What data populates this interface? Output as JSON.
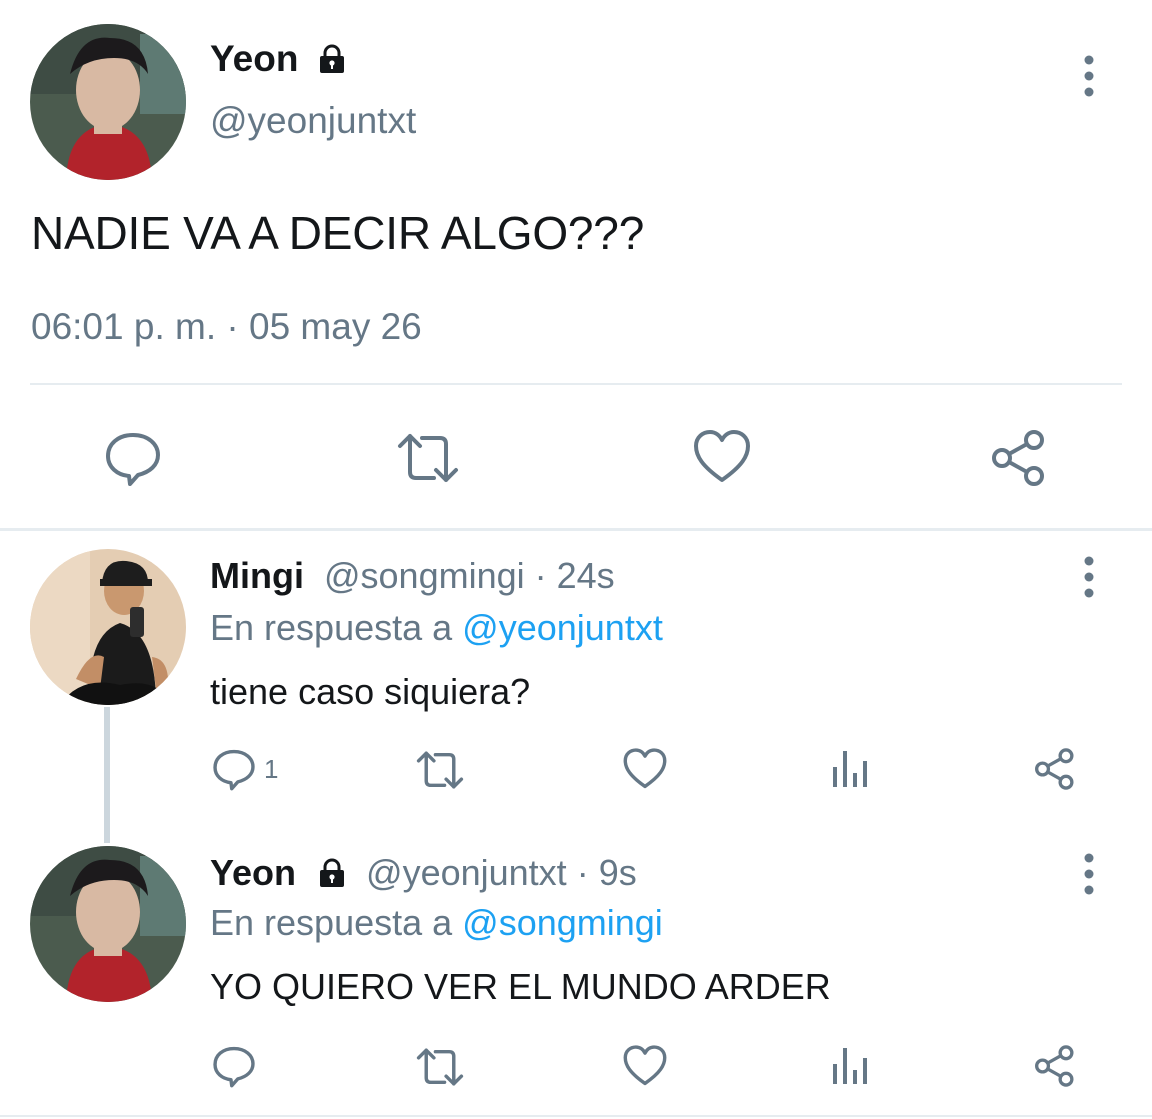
{
  "colors": {
    "text_primary": "#14171a",
    "text_secondary": "#657786",
    "link": "#1da1f2",
    "divider": "#e6ecf0",
    "icon": "#657786",
    "thread_line": "#ccd6dd"
  },
  "main_tweet": {
    "author_name": "Yeon",
    "author_handle": "@yeonjuntxt",
    "protected_icon": "lock-icon",
    "text": "NADIE VA A DECIR ALGO???",
    "timestamp": "06:01 p. m. · 05 may 26",
    "actions": [
      "reply-icon",
      "retweet-icon",
      "like-icon",
      "share-icon"
    ]
  },
  "replies": [
    {
      "author_name": "Mingi",
      "author_handle": "@songmingi",
      "separator": "·",
      "time": "24s",
      "reply_prefix": "En respuesta a ",
      "reply_mention": "@yeonjuntxt",
      "text": "tiene caso siquiera?",
      "reply_count": "1",
      "actions": [
        "reply-icon",
        "retweet-icon",
        "like-icon",
        "views-icon",
        "share-icon"
      ]
    },
    {
      "author_name": "Yeon",
      "author_handle": "@yeonjuntxt",
      "separator": "·",
      "time": "9s",
      "reply_prefix": "En respuesta a ",
      "reply_mention": "@songmingi",
      "text": "YO QUIERO VER EL MUNDO ARDER",
      "reply_count": "",
      "actions": [
        "reply-icon",
        "retweet-icon",
        "like-icon",
        "views-icon",
        "share-icon"
      ]
    }
  ]
}
